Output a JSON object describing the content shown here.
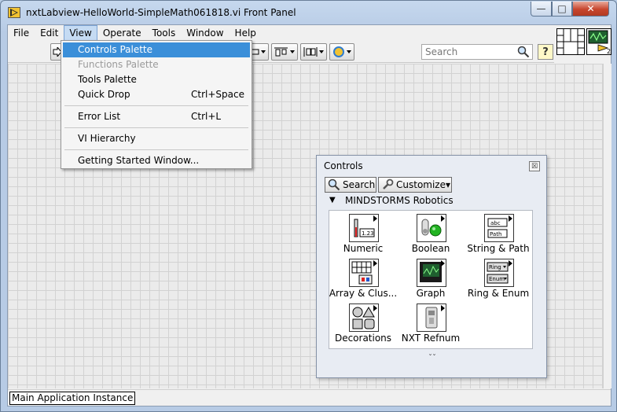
{
  "window": {
    "title": "nxtLabview-HelloWorld-SimpleMath061818.vi Front Panel",
    "minimize_symbol": "—",
    "maximize_symbol": "□",
    "close_symbol": "✕"
  },
  "menubar": {
    "items": [
      {
        "label": "File"
      },
      {
        "label": "Edit"
      },
      {
        "label": "View",
        "active": true
      },
      {
        "label": "Operate"
      },
      {
        "label": "Tools"
      },
      {
        "label": "Window"
      },
      {
        "label": "Help"
      }
    ]
  },
  "toolbar": {
    "search_placeholder": "Search",
    "help_label": "?",
    "buttons": [
      "run-arrow",
      "text-settings",
      "align-objects",
      "distribute-objects",
      "reorder"
    ],
    "connector_pane_number": "2"
  },
  "view_menu": {
    "items": [
      {
        "label": "Controls Palette",
        "shortcut": "",
        "highlighted": true,
        "disabled": false
      },
      {
        "label": "Functions Palette",
        "shortcut": "",
        "highlighted": false,
        "disabled": true
      },
      {
        "label": "Tools Palette",
        "shortcut": "",
        "highlighted": false,
        "disabled": false
      },
      {
        "label": "Quick Drop",
        "shortcut": "Ctrl+Space",
        "highlighted": false,
        "disabled": false
      },
      {
        "label": "Error List",
        "shortcut": "Ctrl+L",
        "highlighted": false,
        "disabled": false
      },
      {
        "label": "VI Hierarchy",
        "shortcut": "",
        "highlighted": false,
        "disabled": false
      },
      {
        "label": "Getting Started Window...",
        "shortcut": "",
        "highlighted": false,
        "disabled": false
      }
    ]
  },
  "controls_palette": {
    "title": "Controls",
    "close_symbol": "☒",
    "search_label": "Search",
    "customize_label": "Customize▾",
    "category": "MINDSTORMS Robotics",
    "expand_arrow": "▼",
    "more_symbol": "ˇˇ",
    "items": [
      {
        "label": "Numeric",
        "icon": "numeric-icon"
      },
      {
        "label": "Boolean",
        "icon": "boolean-icon"
      },
      {
        "label": "String & Path",
        "icon": "string-path-icon"
      },
      {
        "label": "Array & Clus...",
        "icon": "array-cluster-icon"
      },
      {
        "label": "Graph",
        "icon": "graph-icon"
      },
      {
        "label": "Ring & Enum",
        "icon": "ring-enum-icon"
      },
      {
        "label": "Decorations",
        "icon": "decorations-icon"
      },
      {
        "label": "NXT Refnum",
        "icon": "nxt-refnum-icon"
      }
    ]
  },
  "status_bar": {
    "instance": "Main Application Instance"
  },
  "colors": {
    "menu_highlight": "#3b8fd9",
    "title_bar": "#b7cbe5",
    "close_button": "#c7452d",
    "boolean_led": "#22b322"
  }
}
